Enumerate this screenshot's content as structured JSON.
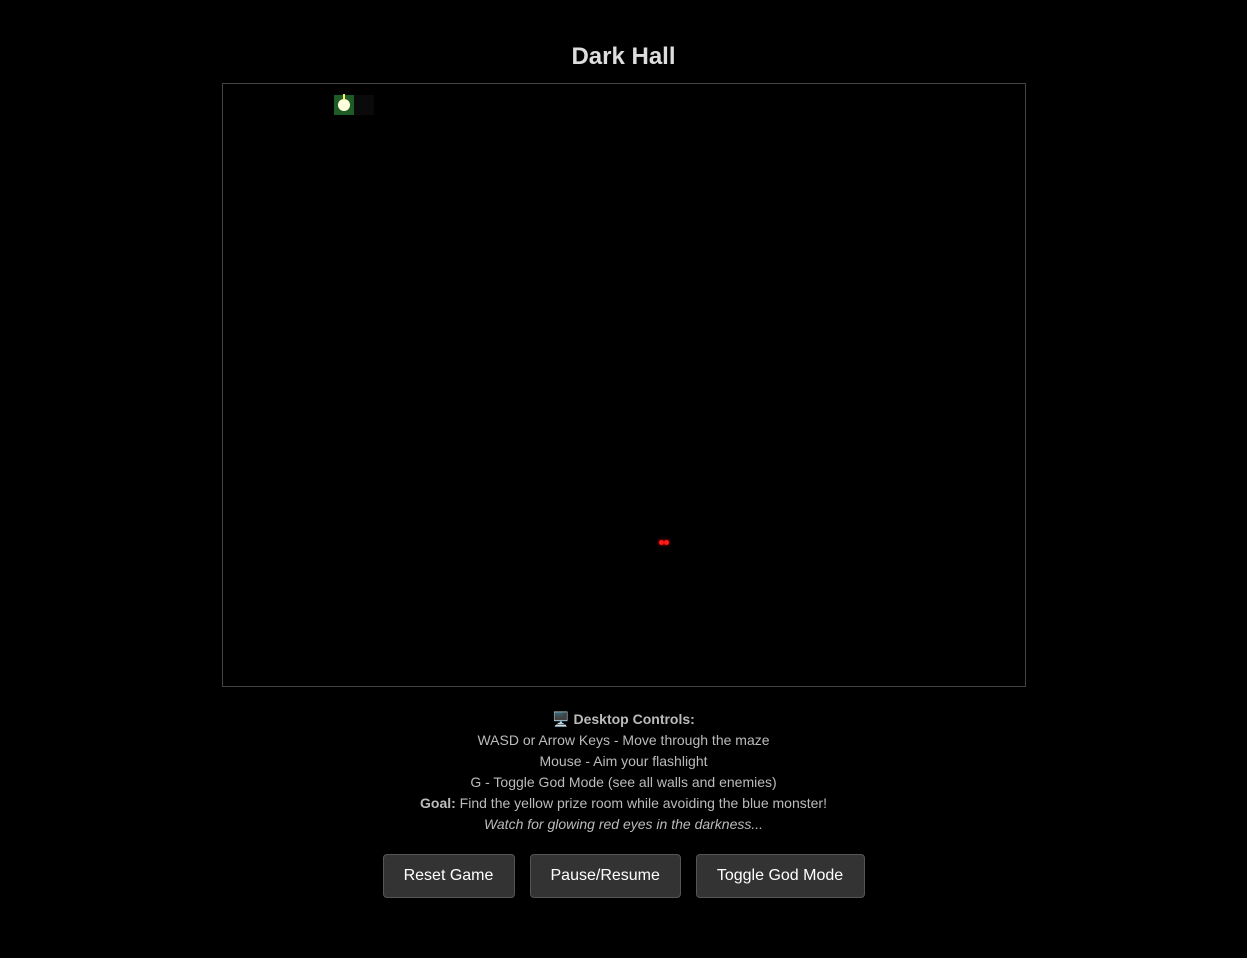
{
  "title": "Dark Hall",
  "controls": {
    "heading_icon": "🖥️",
    "heading": "Desktop Controls:",
    "lines": [
      "WASD or Arrow Keys - Move through the maze",
      "Mouse - Aim your flashlight",
      "G - Toggle God Mode (see all walls and enemies)"
    ],
    "goal_label": "Goal:",
    "goal_text": " Find the yellow prize room while avoiding the blue monster!",
    "hint": "Watch for glowing red eyes in the darkness..."
  },
  "buttons": {
    "reset": "Reset Game",
    "pause": "Pause/Resume",
    "god_mode": "Toggle God Mode"
  },
  "colors": {
    "background": "#000000",
    "player_tile": "#1f5b24",
    "player": "#ffffe0",
    "enemy_eyes": "#ff1a1a",
    "button_bg": "#333333"
  }
}
